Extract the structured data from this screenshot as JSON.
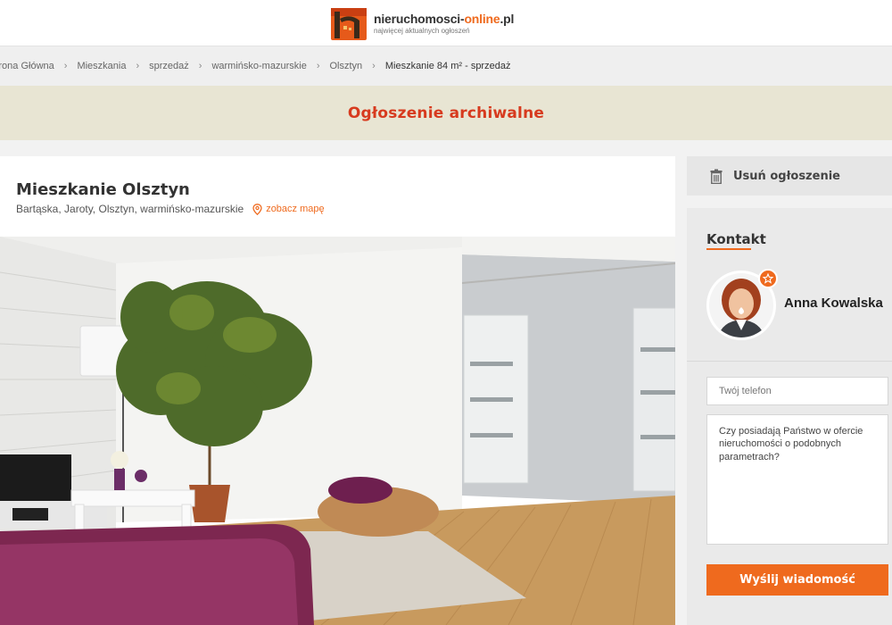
{
  "brand": {
    "name_main": "nieruchomosci-",
    "name_accent": "online",
    "name_tld": ".pl",
    "tagline": "najwięcej aktualnych ogłoszeń",
    "accent_color": "#ef6a1e"
  },
  "breadcrumb": {
    "items": [
      "Strona Główna",
      "Mieszkania",
      "sprzedaż",
      "warmińsko-mazurskie",
      "Olsztyn"
    ],
    "current": "Mieszkanie 84 m² - sprzedaż"
  },
  "archive_notice": "Ogłoszenie archiwalne",
  "listing": {
    "title": "Mieszkanie Olsztyn",
    "location": "Bartąska, Jaroty, Olsztyn, warmińsko-mazurskie",
    "map_link": "zobacz mapę",
    "photo_icon": "apartment-photo"
  },
  "sidebar": {
    "delete_label": "Usuń ogłoszenie",
    "delete_icon": "trash-icon",
    "contact": {
      "heading": "Kontakt",
      "agent_name": "Anna Kowalska",
      "badge_icon": "star-icon",
      "phone_placeholder": "Twój telefon",
      "message": "Czy posiadają Państwo w ofercie nieruchomości o podobnych parametrach?",
      "send_label": "Wyślij wiadomość"
    }
  }
}
